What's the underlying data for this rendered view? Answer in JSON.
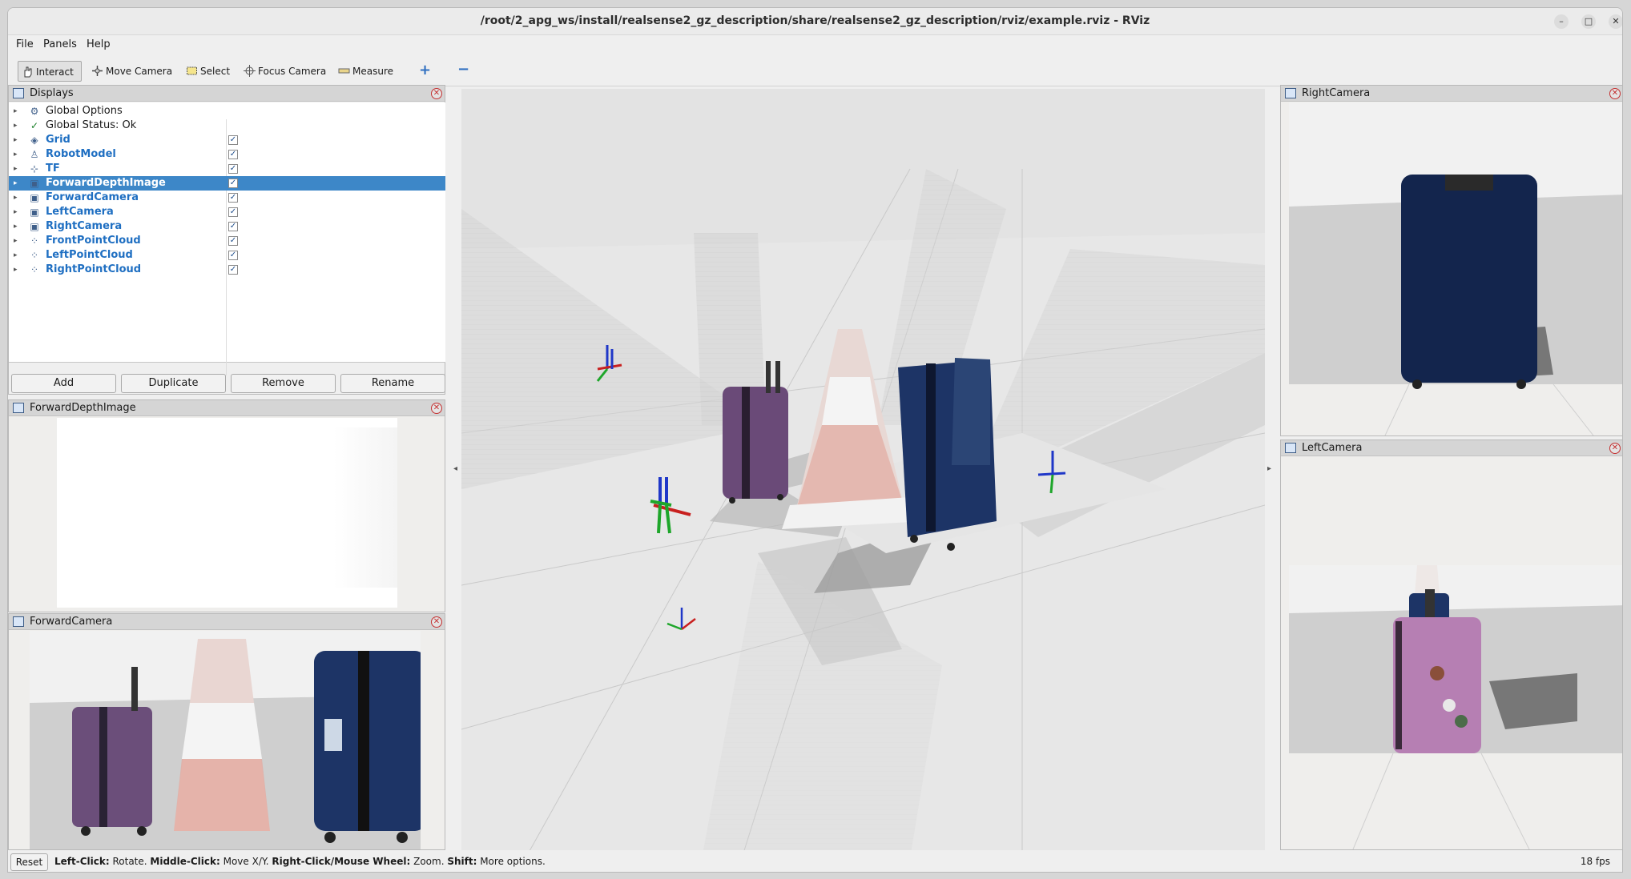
{
  "window": {
    "title": "/root/2_apg_ws/install/realsense2_gz_description/share/realsense2_gz_description/rviz/example.rviz - RViz"
  },
  "menubar": {
    "items": [
      "File",
      "Panels",
      "Help"
    ]
  },
  "toolbar": {
    "tools": [
      {
        "label": "Interact",
        "icon": "hand-icon",
        "active": true
      },
      {
        "label": "Move Camera",
        "icon": "move-camera-icon"
      },
      {
        "label": "Select",
        "icon": "select-icon"
      },
      {
        "label": "Focus Camera",
        "icon": "focus-camera-icon"
      },
      {
        "label": "Measure",
        "icon": "ruler-icon"
      }
    ],
    "add_icon": "+",
    "remove_icon": "−"
  },
  "displays": {
    "title": "Displays",
    "items": [
      {
        "label": "Global Options",
        "icon": "gear-icon",
        "checkbox": false,
        "bold": false
      },
      {
        "label": "Global Status: Ok",
        "icon": "checkmark-icon",
        "checkbox": false,
        "bold": false
      },
      {
        "label": "Grid",
        "icon": "grid-icon",
        "checkbox": true,
        "bold": true
      },
      {
        "label": "RobotModel",
        "icon": "robot-icon",
        "checkbox": true,
        "bold": true
      },
      {
        "label": "TF",
        "icon": "axes-icon",
        "checkbox": true,
        "bold": true
      },
      {
        "label": "ForwardDepthImage",
        "icon": "image-icon",
        "checkbox": true,
        "bold": true,
        "selected": true
      },
      {
        "label": "ForwardCamera",
        "icon": "image-icon",
        "checkbox": true,
        "bold": true
      },
      {
        "label": "LeftCamera",
        "icon": "image-icon",
        "checkbox": true,
        "bold": true
      },
      {
        "label": "RightCamera",
        "icon": "image-icon",
        "checkbox": true,
        "bold": true
      },
      {
        "label": "FrontPointCloud",
        "icon": "pointcloud-icon",
        "checkbox": true,
        "bold": true
      },
      {
        "label": "LeftPointCloud",
        "icon": "pointcloud-icon",
        "checkbox": true,
        "bold": true
      },
      {
        "label": "RightPointCloud",
        "icon": "pointcloud-icon",
        "checkbox": true,
        "bold": true
      }
    ],
    "buttons": {
      "add": "Add",
      "duplicate": "Duplicate",
      "remove": "Remove",
      "rename": "Rename"
    }
  },
  "panels": {
    "forward_depth": "ForwardDepthImage",
    "forward_camera": "ForwardCamera",
    "right_camera": "RightCamera",
    "left_camera": "LeftCamera"
  },
  "statusbar": {
    "reset": "Reset",
    "hint_parts": [
      {
        "b": "Left-Click:",
        "t": " Rotate. "
      },
      {
        "b": "Middle-Click:",
        "t": " Move X/Y. "
      },
      {
        "b": "Right-Click/Mouse Wheel:",
        "t": " Zoom. "
      },
      {
        "b": "Shift:",
        "t": " More options."
      }
    ],
    "fps": "18 fps"
  },
  "colors": {
    "selection": "#3d87c8",
    "link_blue": "#1f6fc2",
    "suitcase_blue": "#1d3466",
    "suitcase_purple": "#6a4a78",
    "cone_red": "#e07a6a"
  }
}
